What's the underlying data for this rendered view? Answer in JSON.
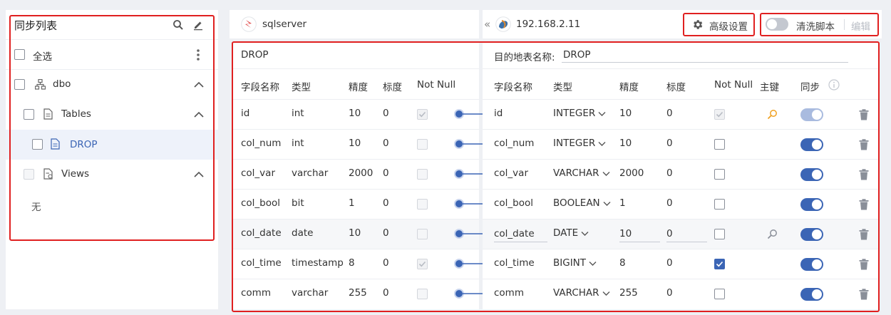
{
  "left_panel": {
    "title": "同步列表",
    "select_all": "全选",
    "tree": {
      "schema": "dbo",
      "tables_group": "Tables",
      "table_item": "DROP",
      "views_group": "Views",
      "views_empty": "无"
    }
  },
  "source": {
    "connection_name": "sqlserver",
    "table_name": "DROP",
    "headers": [
      "字段名称",
      "类型",
      "精度",
      "标度",
      "Not Null"
    ],
    "rows": [
      {
        "name": "id",
        "type": "int",
        "precision": "10",
        "scale": "0",
        "not_null": true
      },
      {
        "name": "col_num",
        "type": "int",
        "precision": "10",
        "scale": "0",
        "not_null": false
      },
      {
        "name": "col_var",
        "type": "varchar",
        "precision": "2000",
        "scale": "0",
        "not_null": false
      },
      {
        "name": "col_bool",
        "type": "bit",
        "precision": "1",
        "scale": "0",
        "not_null": false
      },
      {
        "name": "col_date",
        "type": "date",
        "precision": "10",
        "scale": "0",
        "not_null": false
      },
      {
        "name": "col_time",
        "type": "timestamp",
        "precision": "8",
        "scale": "0",
        "not_null": true
      },
      {
        "name": "comm",
        "type": "varchar",
        "precision": "255",
        "scale": "0",
        "not_null": false
      }
    ]
  },
  "target": {
    "collapse_glyph": "«",
    "connection_name": "192.168.2.11",
    "advanced_settings": "高级设置",
    "clean_script": "清洗脚本",
    "edit": "编辑",
    "table_label": "目的地表名称:",
    "table_name": "DROP",
    "headers": [
      "字段名称",
      "类型",
      "精度",
      "标度",
      "Not Null",
      "主键",
      "同步"
    ],
    "rows": [
      {
        "name": "id",
        "type": "INTEGER",
        "precision": "10",
        "scale": "0",
        "not_null": "disabled-checked",
        "primary_key": "key-orange",
        "sync": "light"
      },
      {
        "name": "col_num",
        "type": "INTEGER",
        "precision": "10",
        "scale": "0",
        "not_null": "unchecked",
        "primary_key": "",
        "sync": "on"
      },
      {
        "name": "col_var",
        "type": "VARCHAR",
        "precision": "2000",
        "scale": "0",
        "not_null": "unchecked",
        "primary_key": "",
        "sync": "on"
      },
      {
        "name": "col_bool",
        "type": "BOOLEAN",
        "precision": "1",
        "scale": "0",
        "not_null": "unchecked",
        "primary_key": "",
        "sync": "on"
      },
      {
        "name": "col_date",
        "type": "DATE",
        "precision": "10",
        "scale": "0",
        "not_null": "unchecked",
        "primary_key": "key-gray",
        "sync": "on"
      },
      {
        "name": "col_time",
        "type": "BIGINT",
        "precision": "8",
        "scale": "0",
        "not_null": "checked",
        "primary_key": "",
        "sync": "on"
      },
      {
        "name": "comm",
        "type": "VARCHAR",
        "precision": "255",
        "scale": "0",
        "not_null": "unchecked",
        "primary_key": "",
        "sync": "on"
      }
    ]
  },
  "colors": {
    "accent": "#3b65b5",
    "highlight_border": "#e02020",
    "key_orange": "#f0a020",
    "selected_bg": "#eef2fa"
  }
}
